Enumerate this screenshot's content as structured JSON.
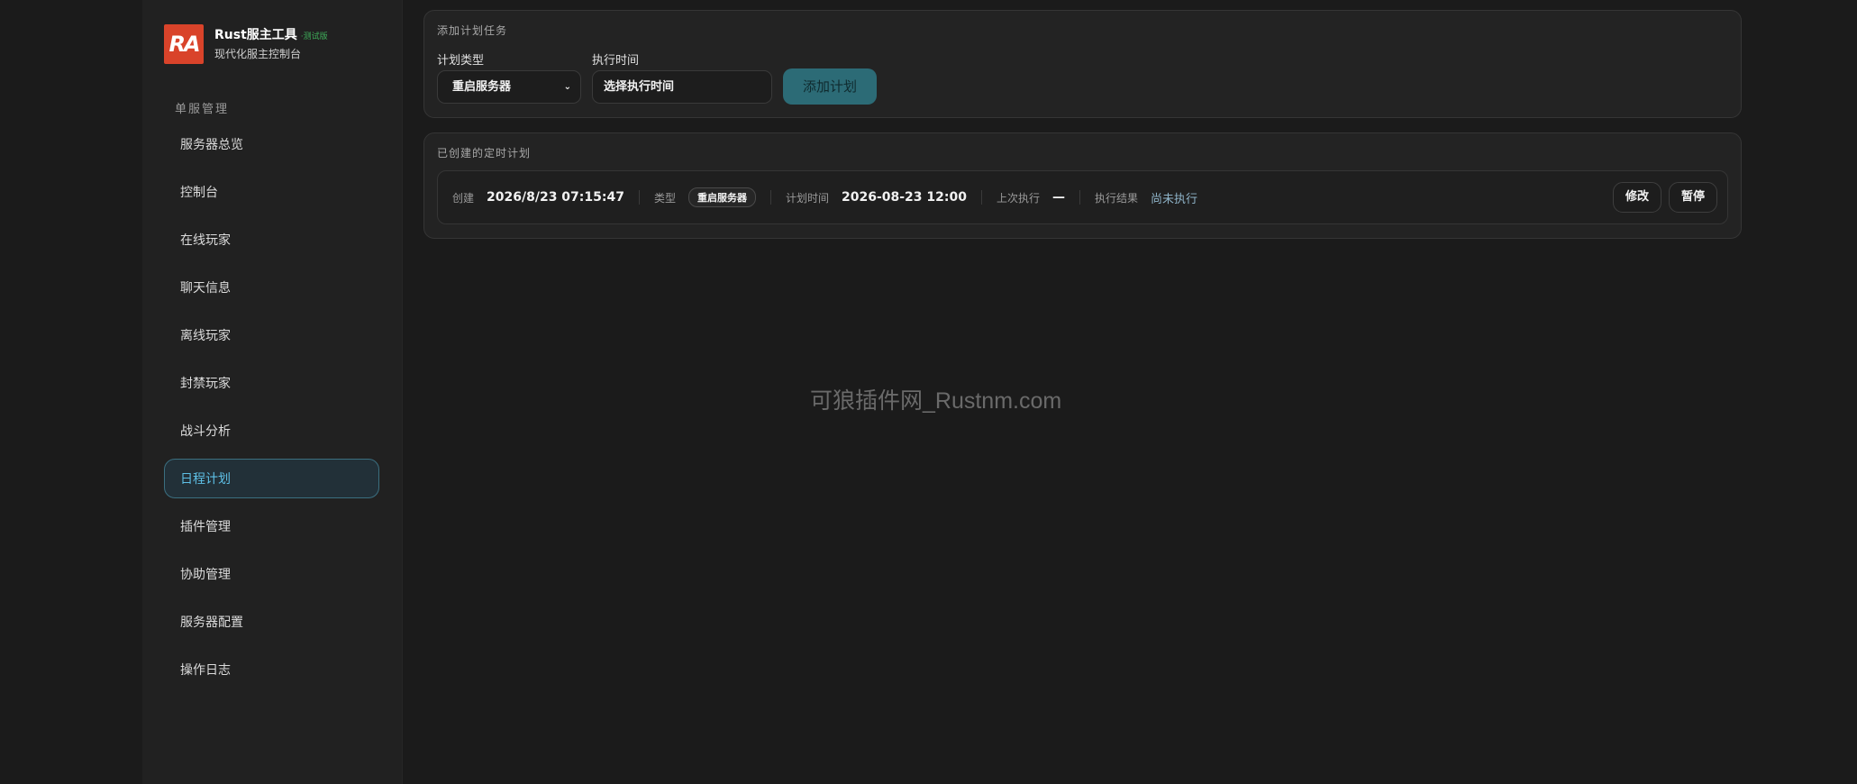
{
  "brand": {
    "logo_text": "RA",
    "title": "Rust服主工具",
    "badge": "·测试版",
    "subtitle": "现代化服主控制台"
  },
  "sidebar": {
    "section": "单服管理",
    "items": [
      {
        "label": "服务器总览"
      },
      {
        "label": "控制台"
      },
      {
        "label": "在线玩家"
      },
      {
        "label": "聊天信息"
      },
      {
        "label": "离线玩家"
      },
      {
        "label": "封禁玩家"
      },
      {
        "label": "战斗分析"
      },
      {
        "label": "日程计划",
        "active": true
      },
      {
        "label": "插件管理"
      },
      {
        "label": "协助管理"
      },
      {
        "label": "服务器配置"
      },
      {
        "label": "操作日志"
      }
    ]
  },
  "add_panel": {
    "title": "添加计划任务",
    "type_label": "计划类型",
    "type_value": "重启服务器",
    "time_label": "执行时间",
    "time_value": "选择执行时间",
    "add_button": "添加计划"
  },
  "list_panel": {
    "title": "已创建的定时计划",
    "tasks": [
      {
        "created_label": "创建",
        "created_value": "2026/8/23 07:15:47",
        "type_label": "类型",
        "type_value": "重启服务器",
        "plan_time_label": "计划时间",
        "plan_time_value": "2026-08-23 12:00",
        "last_run_label": "上次执行",
        "last_run_value": "—",
        "result_label": "执行结果",
        "result_value": "尚未执行",
        "edit_button": "修改",
        "pause_button": "暂停"
      }
    ]
  },
  "watermark": "可狼插件网_Rustnm.com",
  "colors": {
    "background": "#1b1b1b",
    "sidebar": "#212121",
    "accent": "#5ec0e6",
    "add_button": "#2c6b76",
    "logo": "#d9432a",
    "badge": "#3fae5a"
  }
}
